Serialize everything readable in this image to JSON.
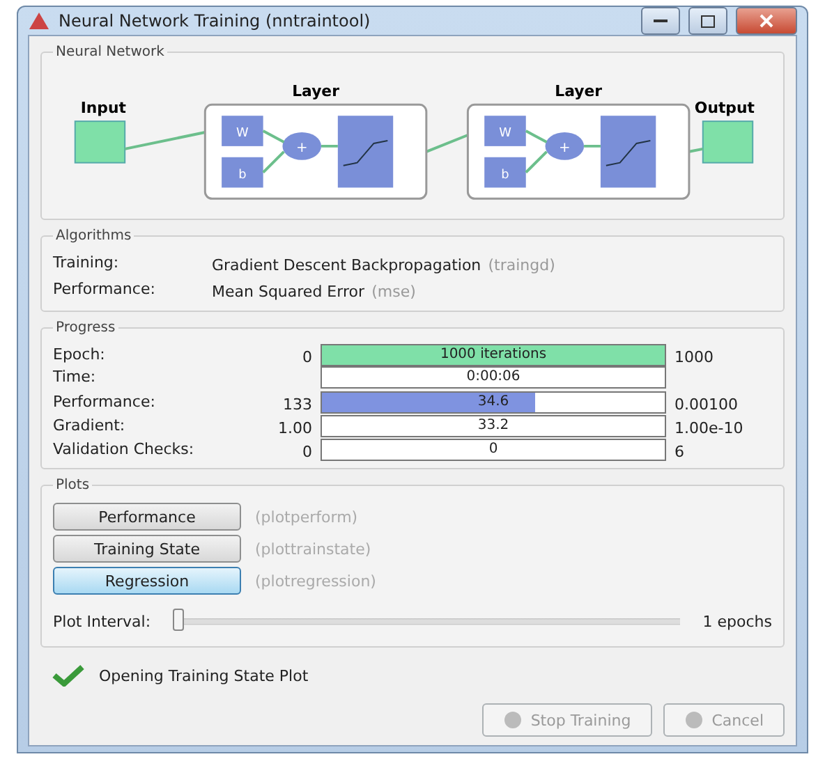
{
  "window": {
    "title": "Neural Network Training (nntraintool)"
  },
  "network": {
    "title": "Neural Network",
    "input": "Input",
    "output": "Output",
    "layers": [
      {
        "label": "Layer",
        "weight": "W",
        "bias": "b",
        "sum": "+"
      },
      {
        "label": "Layer",
        "weight": "W",
        "bias": "b",
        "sum": "+"
      }
    ]
  },
  "algorithms": {
    "title": "Algorithms",
    "rows": [
      {
        "label": "Training:",
        "value": "Gradient Descent Backpropagation",
        "code": "(traingd)"
      },
      {
        "label": "Performance:",
        "value": "Mean Squared Error",
        "code": "(mse)"
      }
    ]
  },
  "progress": {
    "title": "Progress",
    "rows": [
      {
        "label": "Epoch:",
        "start": "0",
        "value": "1000 iterations",
        "end": "1000",
        "level": 1,
        "color": "#7fe0a8"
      },
      {
        "label": "Time:",
        "start": "",
        "value": "0:00:06",
        "end": ""
      },
      {
        "label": "Performance:",
        "start": "133",
        "value": "34.6",
        "end": "0.00100",
        "level": 0.62,
        "color": "#7f93e0"
      },
      {
        "label": "Gradient:",
        "start": "1.00",
        "value": "33.2",
        "end": "1.00e-10"
      },
      {
        "label": "Validation Checks:",
        "start": "0",
        "value": "0",
        "end": "6"
      }
    ]
  },
  "plots": {
    "title": "Plots",
    "buttons": [
      {
        "label": "Performance",
        "code": "(plotperform)",
        "selected": false
      },
      {
        "label": "Training State",
        "code": "(plottrainstate)",
        "selected": false
      },
      {
        "label": "Regression",
        "code": "(plotregression)",
        "selected": true
      }
    ],
    "interval": {
      "label": "Plot Interval:",
      "level": 0,
      "value": "1 epochs"
    }
  },
  "status": "Opening Training State Plot",
  "buttons": [
    {
      "label": "Stop Training",
      "disabled": true
    },
    {
      "label": "Cancel",
      "disabled": true
    }
  ]
}
